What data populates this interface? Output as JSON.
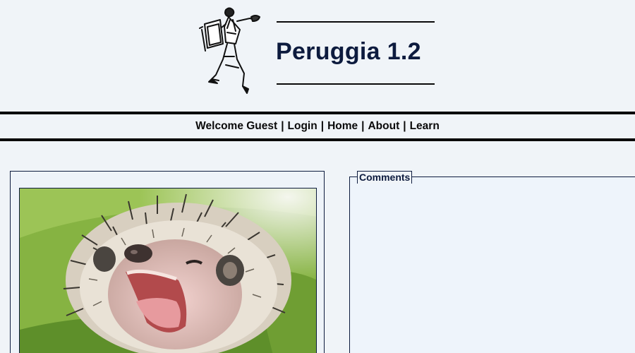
{
  "app": {
    "title": "Peruggia 1.2"
  },
  "nav": {
    "welcome": "Welcome Guest",
    "separator": "|",
    "items": [
      {
        "label": "Login"
      },
      {
        "label": "Home"
      },
      {
        "label": "About"
      },
      {
        "label": "Learn"
      }
    ]
  },
  "main": {
    "picture": {
      "subject": "baby hedgehog yawning on green blanket"
    },
    "comments": {
      "legend": "Comments"
    }
  },
  "colors": {
    "background": "#f0f4f8",
    "title_text": "#0d1b3e",
    "rule": "#0a0a0a",
    "comments_bg": "#eef4fb"
  }
}
